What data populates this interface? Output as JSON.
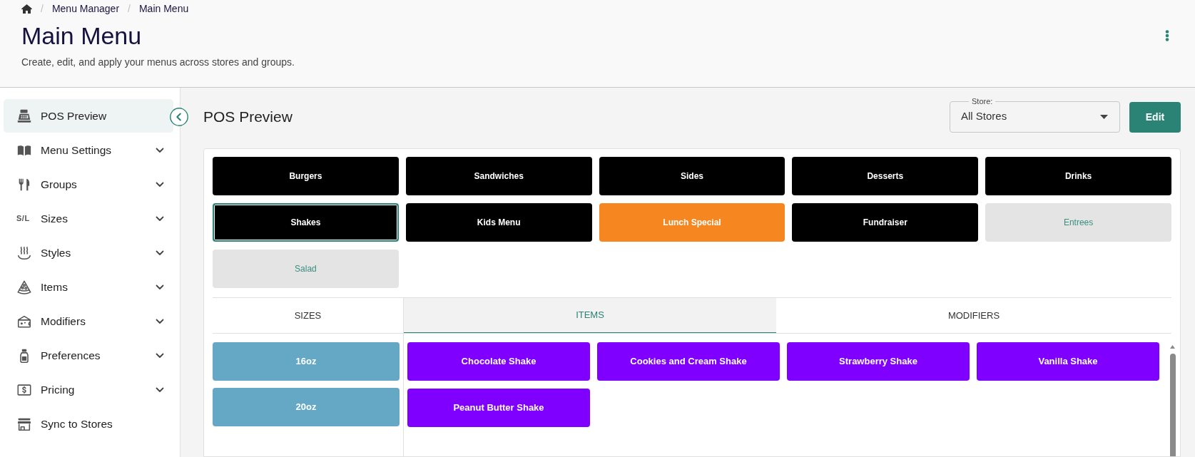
{
  "breadcrumb": {
    "separator": "/",
    "items": [
      "Menu Manager",
      "Main Menu"
    ]
  },
  "page": {
    "title": "Main Menu",
    "subtitle": "Create, edit, and apply your menus across stores and groups."
  },
  "sidebar": {
    "items": [
      {
        "label": "POS Preview",
        "kind": "link",
        "selected": true
      },
      {
        "label": "Menu Settings",
        "kind": "group",
        "selected": false
      },
      {
        "label": "Groups",
        "kind": "group",
        "selected": false
      },
      {
        "label": "Sizes",
        "kind": "group",
        "selected": false,
        "icon_text": "S/L"
      },
      {
        "label": "Styles",
        "kind": "group",
        "selected": false
      },
      {
        "label": "Items",
        "kind": "group",
        "selected": false
      },
      {
        "label": "Modifiers",
        "kind": "group",
        "selected": false
      },
      {
        "label": "Preferences",
        "kind": "group",
        "selected": false
      },
      {
        "label": "Pricing",
        "kind": "group",
        "selected": false
      },
      {
        "label": "Sync to Stores",
        "kind": "link",
        "selected": false
      }
    ]
  },
  "preview": {
    "title": "POS Preview",
    "store_select": {
      "label": "Store:",
      "value": "All Stores"
    },
    "edit_button": "Edit",
    "categories": [
      {
        "label": "Burgers",
        "color": "#000000",
        "selected": false
      },
      {
        "label": "Sandwiches",
        "color": "#000000",
        "selected": false
      },
      {
        "label": "Sides",
        "color": "#000000",
        "selected": false
      },
      {
        "label": "Desserts",
        "color": "#000000",
        "selected": false
      },
      {
        "label": "Drinks",
        "color": "#000000",
        "selected": false
      },
      {
        "label": "Shakes",
        "color": "#000000",
        "selected": true
      },
      {
        "label": "Kids Menu",
        "color": "#000000",
        "selected": false
      },
      {
        "label": "Lunch Special",
        "color": "#f58620",
        "selected": false
      },
      {
        "label": "Fundraiser",
        "color": "#000000",
        "selected": false
      },
      {
        "label": "Entrees",
        "color": "#e4e4e4",
        "selected": false
      },
      {
        "label": "Salad",
        "color": "#e4e4e4",
        "selected": false
      }
    ],
    "sizes_heading": "SIZES",
    "sizes": [
      "16oz",
      "20oz"
    ],
    "tabs": [
      {
        "label": "ITEMS",
        "selected": true
      },
      {
        "label": "MODIFIERS",
        "selected": false
      }
    ],
    "items": [
      "Chocolate Shake",
      "Cookies and Cream Shake",
      "Strawberry Shake",
      "Vanilla Shake",
      "Peanut Butter Shake"
    ]
  }
}
